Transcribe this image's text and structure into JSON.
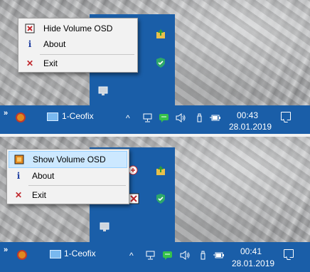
{
  "top": {
    "menu": {
      "items": [
        {
          "label": "Hide Volume OSD",
          "icon": "volume-osd-off-icon"
        },
        {
          "label": "About",
          "icon": "info-icon"
        },
        {
          "label": "Exit",
          "icon": "exit-x-icon"
        }
      ]
    },
    "taskbar": {
      "window_title": "1-Ceofix",
      "time": "00:43",
      "date": "28.01.2019"
    }
  },
  "bottom": {
    "menu": {
      "items": [
        {
          "label": "Show Volume OSD",
          "icon": "volume-osd-on-icon",
          "highlighted": true
        },
        {
          "label": "About",
          "icon": "info-icon"
        },
        {
          "label": "Exit",
          "icon": "exit-x-icon"
        }
      ]
    },
    "taskbar": {
      "window_title": "1-Ceofix",
      "time": "00:41",
      "date": "28.01.2019"
    }
  },
  "glyphs": {
    "overflow_chevron": "»",
    "show_hidden_icons": "^",
    "info": "i",
    "exit": "✕"
  },
  "colors": {
    "taskbar": "#1a5ea8",
    "menu_bg": "#f2f2f2",
    "menu_highlight": "#cce8ff",
    "exit_red": "#c0282d",
    "info_blue": "#1f3fa0"
  }
}
